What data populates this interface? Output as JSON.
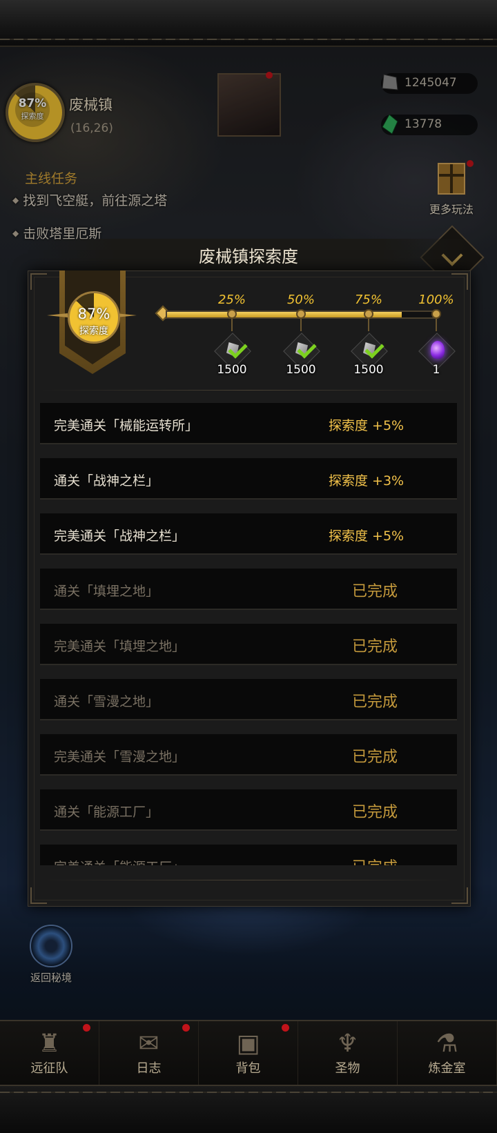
{
  "hud": {
    "map_explore_pct": "87%",
    "map_explore_label": "探索度",
    "map_name": "废械镇",
    "map_coord": "(16,26)",
    "resource1_value": "1245047",
    "resource2_value": "13778",
    "quest_title": "主线任务",
    "quest_items": [
      "找到飞空艇，前往源之塔",
      "击败塔里厄斯"
    ],
    "more_play_label": "更多玩法",
    "return_label": "返回秘境"
  },
  "modal": {
    "title": "废械镇探索度",
    "badge_pct": "87%",
    "badge_label": "探索度",
    "progress_fraction": 0.87,
    "milestones": [
      {
        "pct": "25%",
        "qty": "1500",
        "icon": "ore-checked-icon"
      },
      {
        "pct": "50%",
        "qty": "1500",
        "icon": "ore-checked-icon"
      },
      {
        "pct": "75%",
        "qty": "1500",
        "icon": "ore-checked-icon"
      },
      {
        "pct": "100%",
        "qty": "1",
        "icon": "purple-gem-icon"
      }
    ],
    "tasks": [
      {
        "name": "完美通关「械能运转所」",
        "reward": "探索度 +5%",
        "done": false
      },
      {
        "name": "通关「战神之栏」",
        "reward": "探索度 +3%",
        "done": false
      },
      {
        "name": "完美通关「战神之栏」",
        "reward": "探索度 +5%",
        "done": false
      },
      {
        "name": "通关「填埋之地」",
        "reward": "已完成",
        "done": true
      },
      {
        "name": "完美通关「填埋之地」",
        "reward": "已完成",
        "done": true
      },
      {
        "name": "通关「雪漫之地」",
        "reward": "已完成",
        "done": true
      },
      {
        "name": "完美通关「雪漫之地」",
        "reward": "已完成",
        "done": true
      },
      {
        "name": "通关「能源工厂」",
        "reward": "已完成",
        "done": true
      },
      {
        "name": "完美通关「能源工厂」",
        "reward": "已完成",
        "done": true
      }
    ]
  },
  "nav": {
    "items": [
      {
        "label": "远征队",
        "icon": "helmet-icon",
        "glyph": "♜",
        "badge": true
      },
      {
        "label": "日志",
        "icon": "scroll-icon",
        "glyph": "✉",
        "badge": true
      },
      {
        "label": "背包",
        "icon": "bag-icon",
        "glyph": "▣",
        "badge": true
      },
      {
        "label": "圣物",
        "icon": "chalice-icon",
        "glyph": "♆",
        "badge": false
      },
      {
        "label": "炼金室",
        "icon": "alchemy-icon",
        "glyph": "⚗",
        "badge": false
      }
    ]
  },
  "colors": {
    "accent_gold": "#f1c232",
    "done_text": "#c59a3c",
    "badge_red": "#c0131a"
  }
}
